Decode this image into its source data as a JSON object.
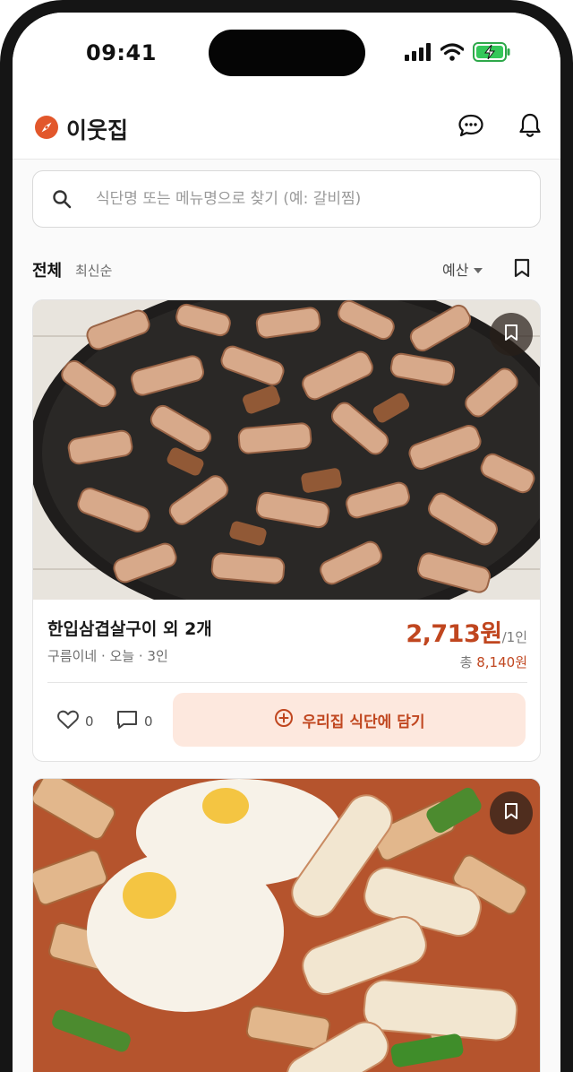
{
  "status_bar": {
    "time": "09:41"
  },
  "app": {
    "name": "이웃집"
  },
  "search": {
    "placeholder": "식단명 또는 메뉴명으로 찾기 (예: 갈비찜)"
  },
  "filter": {
    "category": "전체",
    "sort": "최신순",
    "budget_label": "예산"
  },
  "colors": {
    "accent": "#c0461f",
    "accent_light": "#fde8de",
    "logo": "#e2572b"
  },
  "cards": [
    {
      "title": "한입삼겹살구이 외 2개",
      "meta": "구름이네 · 오늘 · 3인",
      "price": "2,713원",
      "price_unit": "/1인",
      "total_label": "총",
      "total_value": "8,140원",
      "likes": "0",
      "comments": "0",
      "add_label": "우리집 식단에 담기"
    },
    {}
  ]
}
